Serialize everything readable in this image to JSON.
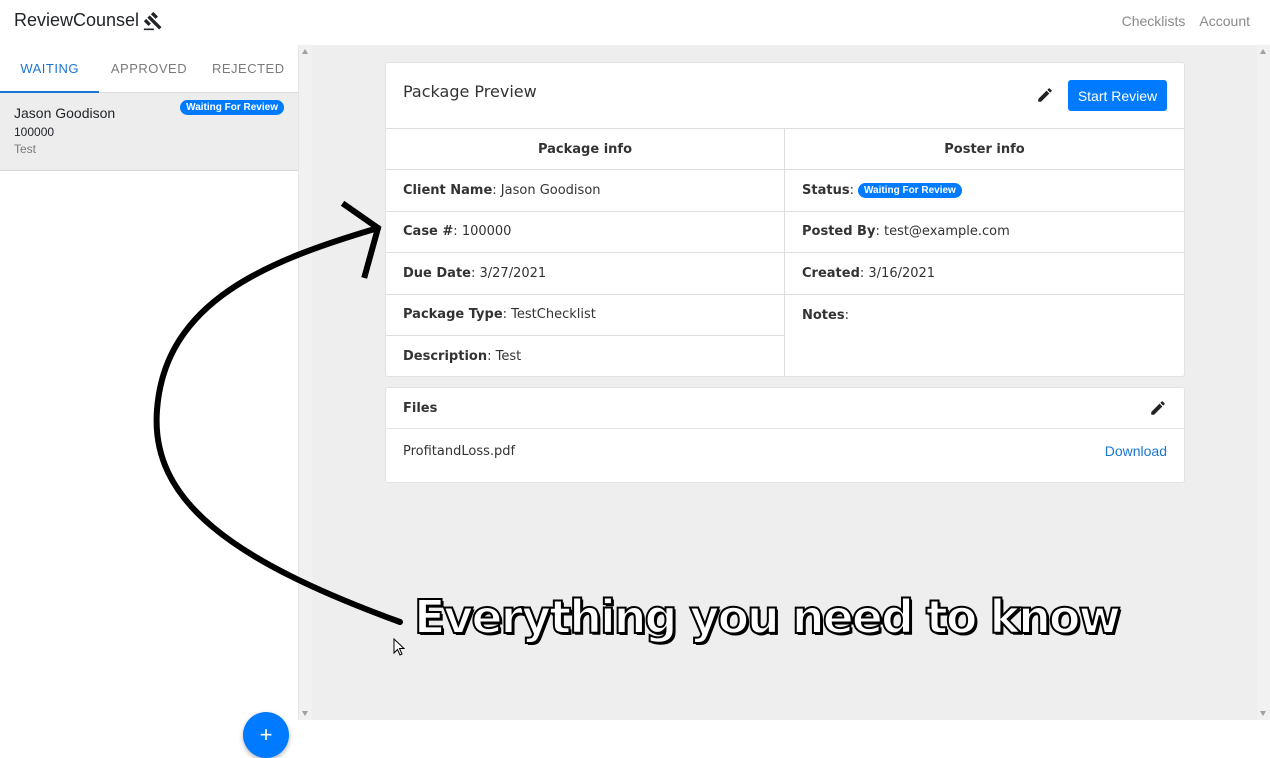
{
  "app": {
    "brand": "ReviewCounsel"
  },
  "topnav": {
    "checklists": "Checklists",
    "account": "Account"
  },
  "sidebar": {
    "tabs": [
      "WAITING",
      "APPROVED",
      "REJECTED"
    ],
    "active_tab": "WAITING",
    "items": [
      {
        "name": "Jason Goodison",
        "case": "100000",
        "desc": "Test",
        "badge": "Waiting For Review"
      }
    ],
    "fab_label": "+"
  },
  "preview": {
    "title": "Package Preview",
    "start_review": "Start Review",
    "package_info_header": "Package info",
    "poster_info_header": "Poster info",
    "client_name_label": "Client Name",
    "client_name": "Jason Goodison",
    "case_label": "Case #",
    "case": "100000",
    "due_date_label": "Due Date",
    "due_date": "3/27/2021",
    "package_type_label": "Package Type",
    "package_type": "TestChecklist",
    "description_label": "Description",
    "description": "Test",
    "status_label": "Status",
    "status": "Waiting For Review",
    "posted_by_label": "Posted By",
    "posted_by": "test@example.com",
    "created_label": "Created",
    "created": "3/16/2021",
    "notes_label": "Notes",
    "notes": ""
  },
  "files": {
    "title": "Files",
    "items": [
      {
        "name": "ProfitandLoss.pdf",
        "action": "Download"
      }
    ]
  },
  "caption": "Everything you need to know",
  "colors": {
    "accent": "#007bff",
    "link": "#1976d2",
    "background": "#eeeeee"
  },
  "icons": {
    "brand": "gavel-icon",
    "edit": "pencil-icon",
    "add": "plus-icon"
  }
}
